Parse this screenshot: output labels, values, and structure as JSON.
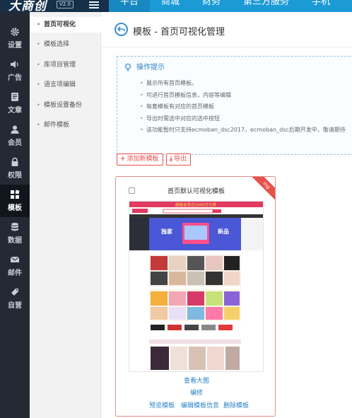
{
  "brand": {
    "logo": "大商创",
    "version": "V2.0"
  },
  "top_nav": [
    "平台",
    "商城",
    "财务",
    "第三方服务",
    "手机"
  ],
  "icon_sidebar": [
    {
      "label": "设置",
      "icon": "gear-icon"
    },
    {
      "label": "广告",
      "icon": "speaker-icon"
    },
    {
      "label": "文章",
      "icon": "document-icon"
    },
    {
      "label": "会员",
      "icon": "user-icon"
    },
    {
      "label": "权限",
      "icon": "lock-icon"
    },
    {
      "label": "模板",
      "icon": "grid-icon"
    },
    {
      "label": "数据",
      "icon": "database-icon"
    },
    {
      "label": "邮件",
      "icon": "mail-icon"
    },
    {
      "label": "自营",
      "icon": "bag-icon"
    }
  ],
  "sub_nav": [
    "首页可视化",
    "模板选择",
    "库项目管理",
    "语言项编辑",
    "模板设置备份",
    "邮件模板"
  ],
  "page_title": "模板 - 首页可视化管理",
  "tips": {
    "title": "操作提示",
    "items": [
      "展示所有首页模板。",
      "可进行首页模板信息，内容等编辑",
      "每套模板有对应的首页模板",
      "导出时需选中对应的选中按钮",
      "该功能暂时只支持ecmoban_dsc2017，ecmoban_dsc后期开发中，敬请期待"
    ]
  },
  "buttons": {
    "add": "添加新模板",
    "export": "导出"
  },
  "template_card": {
    "ribbon": "ing",
    "title": "首页默认可视化模板",
    "thumb_banner_text": "超级会员日1000万元券",
    "thumb_hero_left": "独家",
    "thumb_hero_right": "新品",
    "view_large": "查看大图",
    "edit": "编修",
    "preview": "预览模板",
    "edit_info": "编辑模板信息",
    "delete": "删除模板"
  },
  "colors": {
    "topbar": "#1b9ad6",
    "sidebar": "#232a34",
    "accent": "#e8504b",
    "link": "#2a83c6"
  }
}
